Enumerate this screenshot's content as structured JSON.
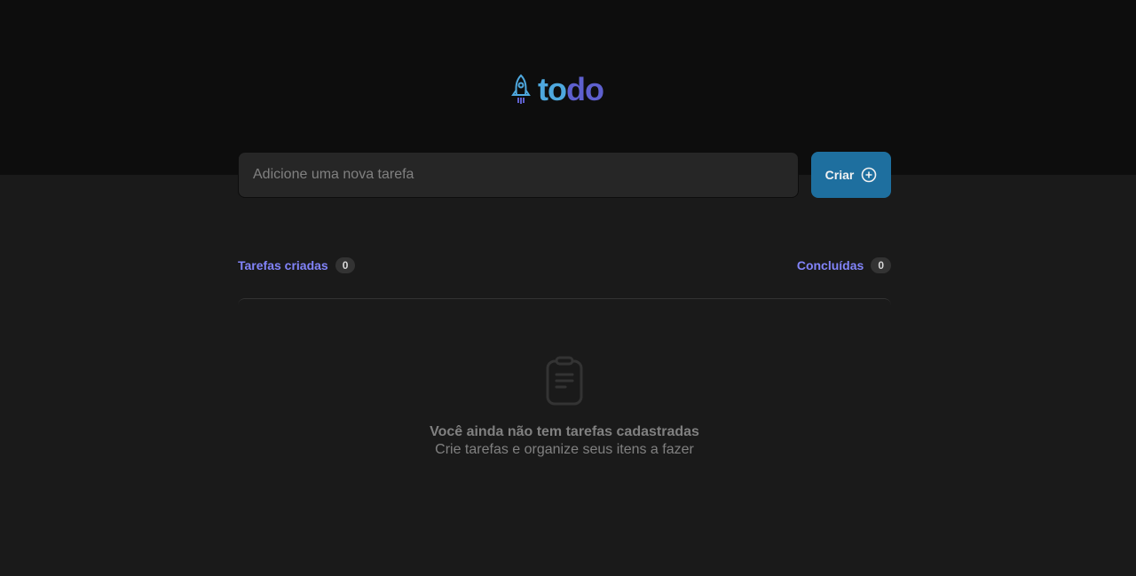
{
  "logo": {
    "part1": "to",
    "part2": "do"
  },
  "form": {
    "placeholder": "Adicione uma nova tarefa",
    "create_label": "Criar"
  },
  "counters": {
    "created_label": "Tarefas criadas",
    "created_count": "0",
    "done_label": "Concluídas",
    "done_count": "0"
  },
  "empty": {
    "title": "Você ainda não tem tarefas cadastradas",
    "subtitle": "Crie tarefas e organize seus itens a fazer"
  },
  "colors": {
    "blue": "#4ea8de",
    "purple": "#5e60ce",
    "button": "#1e6f9f",
    "counter": "#8284fa"
  }
}
